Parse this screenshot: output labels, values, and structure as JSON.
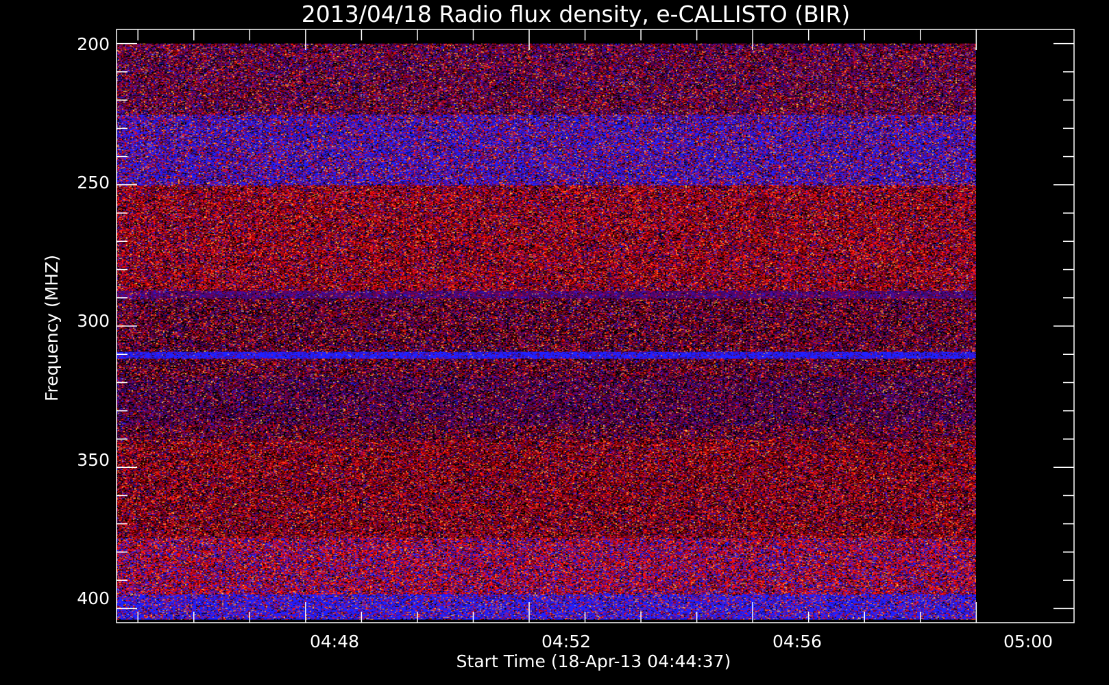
{
  "chart_data": {
    "type": "heatmap",
    "title": "2013/04/18  Radio flux density, e-CALLISTO (BIR)",
    "xlabel": "Start Time (18-Apr-13 04:44:37)",
    "ylabel": "Frequency (MHZ)",
    "x_ticks": [
      "04:48",
      "04:52",
      "04:56",
      "05:00"
    ],
    "y_ticks": [
      "200",
      "250",
      "300",
      "350",
      "400"
    ],
    "x_range": [
      "04:44:37",
      "05:00:00"
    ],
    "x_axis_range": [
      "04:44:37",
      "05:01:45"
    ],
    "y_range": [
      200,
      404
    ],
    "y_axis_range": [
      195,
      405
    ],
    "y_reversed": true,
    "grid": false,
    "colormap": [
      "#000000",
      "#3a0a6a",
      "#6a0070",
      "#8a0000",
      "#2020ff",
      "#ff1010",
      "#ff8030",
      "#ffd050"
    ],
    "bands_mhz": [
      {
        "from": 200,
        "to": 225,
        "tone": "purple-red mix"
      },
      {
        "from": 225,
        "to": 250,
        "tone": "blue"
      },
      {
        "from": 250,
        "to": 290,
        "tone": "red"
      },
      {
        "from": 288,
        "to": 290,
        "tone": "violet line"
      },
      {
        "from": 309,
        "to": 311,
        "tone": "blue line"
      },
      {
        "from": 320,
        "to": 335,
        "tone": "purple"
      },
      {
        "from": 340,
        "to": 375,
        "tone": "dark red"
      },
      {
        "from": 375,
        "to": 395,
        "tone": "red-blue mix"
      },
      {
        "from": 395,
        "to": 404,
        "tone": "blue"
      }
    ]
  }
}
